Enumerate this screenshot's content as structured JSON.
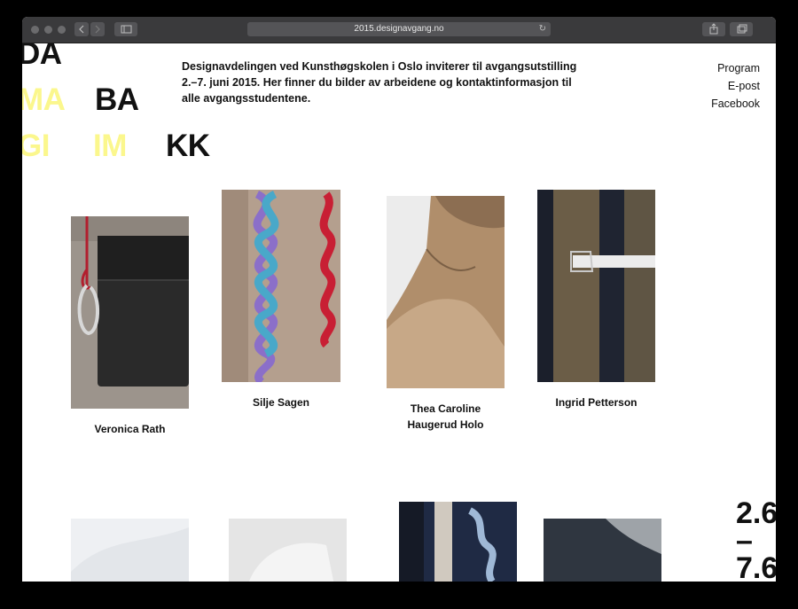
{
  "browser": {
    "url": "2015.designavgang.no",
    "back_icon": "chevron-left-icon",
    "forward_icon": "chevron-right-icon",
    "sidebar_icon": "sidebar-icon",
    "share_icon": "share-icon",
    "tabs_icon": "tabs-icon",
    "reload_icon": "reload-icon"
  },
  "logo": {
    "row1": [
      "DA"
    ],
    "row2": [
      "MA",
      "BA"
    ],
    "row3": [
      "GI",
      "IM",
      "KK"
    ],
    "colors": {
      "dark": "#111111",
      "yellow": "#fbf78d"
    }
  },
  "intro": "Designavdelingen ved Kunsthøgskolen i Oslo inviterer til avgangsutstilling 2.–7. juni 2015. Her finner du bilder av arbeidene og kontaktinformasjon til alle avgangsstudentene.",
  "nav": [
    "Program",
    "E-post",
    "Facebook"
  ],
  "students": [
    {
      "name": "Veronica Rath"
    },
    {
      "name": "Silje Sagen"
    },
    {
      "name": "Thea Caroline Haugerud Holo"
    },
    {
      "name": "Ingrid Petterson"
    }
  ],
  "dates": {
    "start": "2.6",
    "dash": "–",
    "end": "7.6"
  }
}
